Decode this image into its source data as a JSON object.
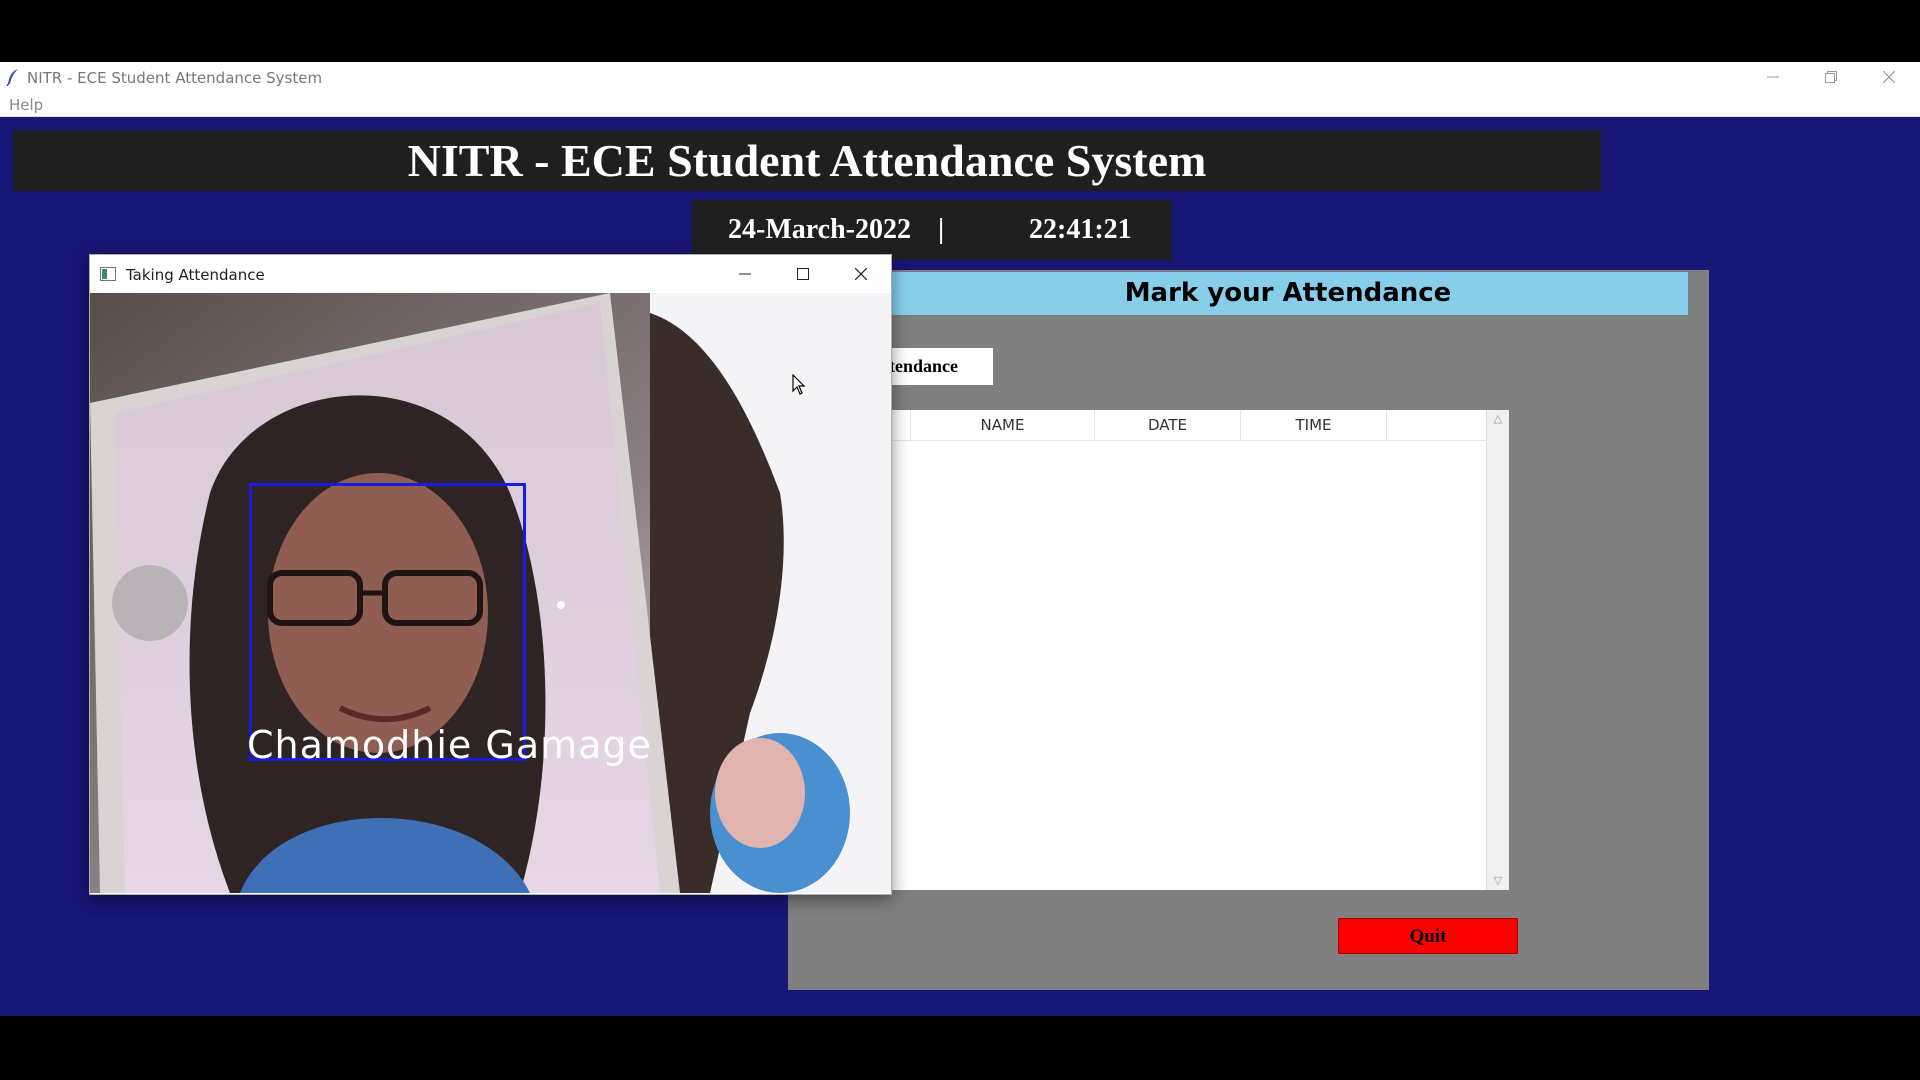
{
  "window": {
    "title": "NITR - ECE Student Attendance System",
    "menu": [
      "Help"
    ]
  },
  "header": {
    "title": "NITR - ECE Student Attendance System"
  },
  "datetime": {
    "date": "24-March-2022",
    "separator": "|",
    "time": "22:41:21"
  },
  "attendance": {
    "title": "Mark your Attendance",
    "take_button_label": "ttendance",
    "table": {
      "columns": [
        "NAME",
        "DATE",
        "TIME"
      ],
      "rows": []
    },
    "quit_label": "Quit"
  },
  "camera_window": {
    "title": "Taking Attendance",
    "recognized_name": "Chamodhie Gamage"
  },
  "colors": {
    "background": "#181676",
    "banner": "#1f1f1f",
    "panel": "#7f7f7f",
    "panel_title": "#87ceeb",
    "quit": "#ff0000",
    "face_box": "#1a1ae0"
  }
}
